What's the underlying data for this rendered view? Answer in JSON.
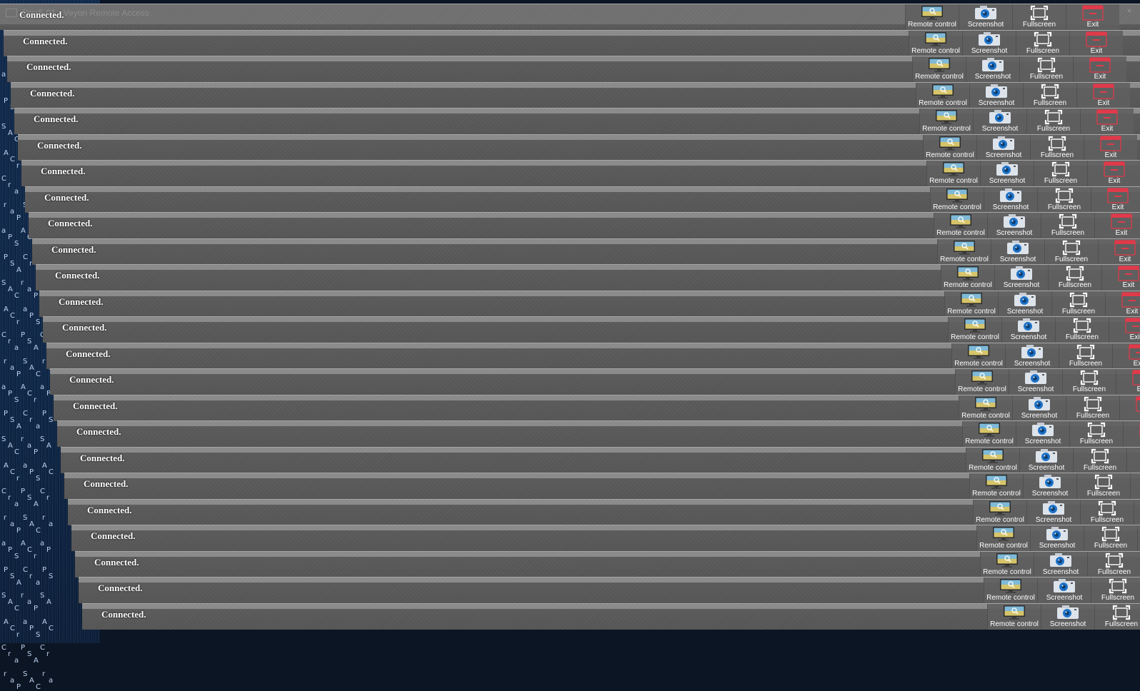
{
  "window": {
    "title": "Ornr5-01 - Veyon Remote Access",
    "status_text": "Connected."
  },
  "toolbar": {
    "buttons": [
      {
        "id": "remote-control",
        "label": "Remote control",
        "icon": "monitor-magnifier-icon"
      },
      {
        "id": "screenshot",
        "label": "Screenshot",
        "icon": "camera-icon"
      },
      {
        "id": "fullscreen",
        "label": "Fullscreen",
        "icon": "fullscreen-icon"
      },
      {
        "id": "exit",
        "label": "Exit",
        "icon": "exit-window-icon"
      }
    ]
  },
  "desktop_fragments": [
    "a",
    "P",
    "S",
    "A",
    "C",
    "r"
  ],
  "repeat_count": 24,
  "colors": {
    "titlebar": "#6f6f6f",
    "body": "#555555",
    "accent_blue": "#1e73c8",
    "exit_red": "#e03a4a"
  }
}
